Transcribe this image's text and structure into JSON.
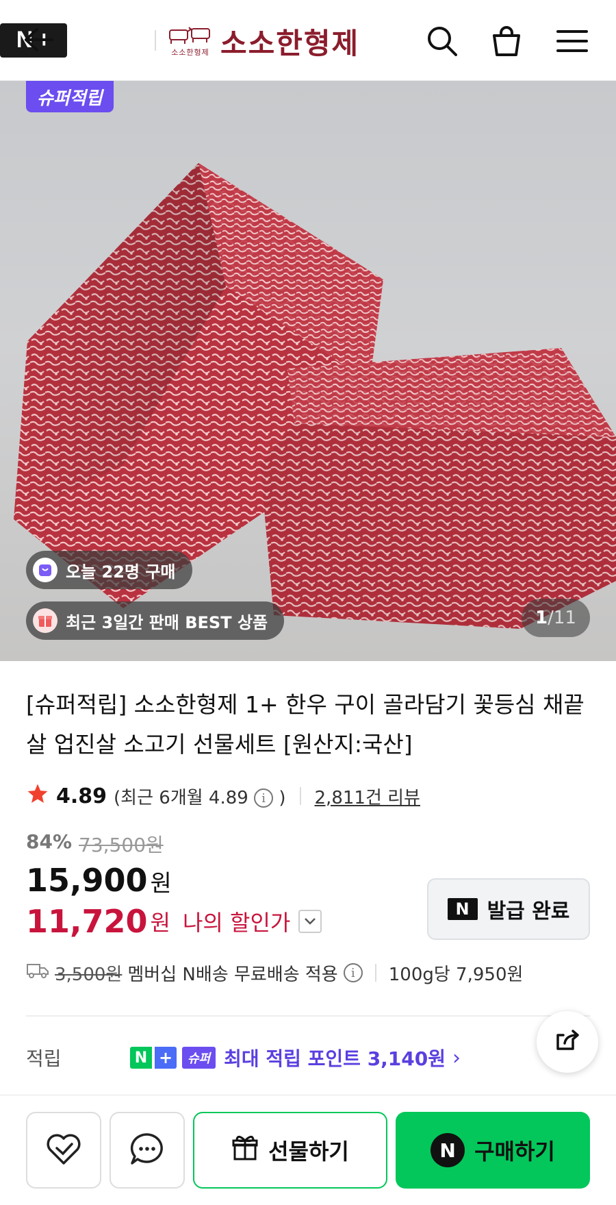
{
  "header": {
    "membership_logo": {
      "n": "N",
      "plus": "+"
    },
    "brand_small": "소소한형제",
    "brand_name": "소소한형제",
    "icons": [
      "back-arrow-icon",
      "search-icon",
      "shopping-bag-icon",
      "menu-icon"
    ]
  },
  "hero": {
    "super_tag": "슈퍼적립",
    "today_buyers": "오늘 22명 구매",
    "best_badge": "최근 3일간 판매 BEST 상품",
    "pager_current": "1",
    "pager_separator": "/",
    "pager_total": "11"
  },
  "product": {
    "title": "[슈퍼적립] 소소한형제 1+ 한우 구이 골라담기 꽃등심 채끝살 업진살 소고기 선물세트 [원산지:국산]",
    "rating": "4.89",
    "recent_rating_prefix": "(최근 6개월 4.89",
    "recent_rating_suffix": ")",
    "review_count": "2,811건 리뷰"
  },
  "price": {
    "discount_rate": "84%",
    "original_price": "73,500원",
    "sale_price": "15,900",
    "sale_unit": "원",
    "my_price": "11,720",
    "my_price_unit": "원",
    "my_price_label": "나의 할인가",
    "coupon_button": "발급 완료",
    "coupon_badge": "N"
  },
  "shipping": {
    "fee_original": "3,500원",
    "fee_text": "멤버십 N배송 무료배송 적용",
    "unit_price": "100g당 7,950원"
  },
  "points": {
    "label": "적립",
    "badge_n": "N",
    "badge_plus": "+",
    "badge_super": "슈퍼",
    "text": "최대 적립 포인트 3,140원",
    "chevron": "›"
  },
  "bottom": {
    "gift_label": "선물하기",
    "buy_label": "구매하기",
    "buy_badge": "N"
  },
  "colors": {
    "naver_green": "#03c75a",
    "price_red": "#c8143c",
    "super_purple": "#6b4df0",
    "brand_maroon": "#8b1d2c"
  }
}
